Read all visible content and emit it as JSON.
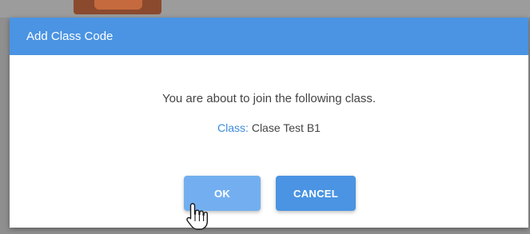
{
  "dialog": {
    "title": "Add Class Code",
    "message": "You are about to join the following class.",
    "class_label": "Class:",
    "class_name": "Clase Test B1",
    "ok_label": "OK",
    "cancel_label": "CANCEL"
  },
  "colors": {
    "header": "#4a94e3",
    "ok_button": "#73aff0",
    "cancel_button": "#4a94e3",
    "class_label": "#3b8bdc"
  },
  "cursor": {
    "icon": "hand-pointer-icon"
  }
}
